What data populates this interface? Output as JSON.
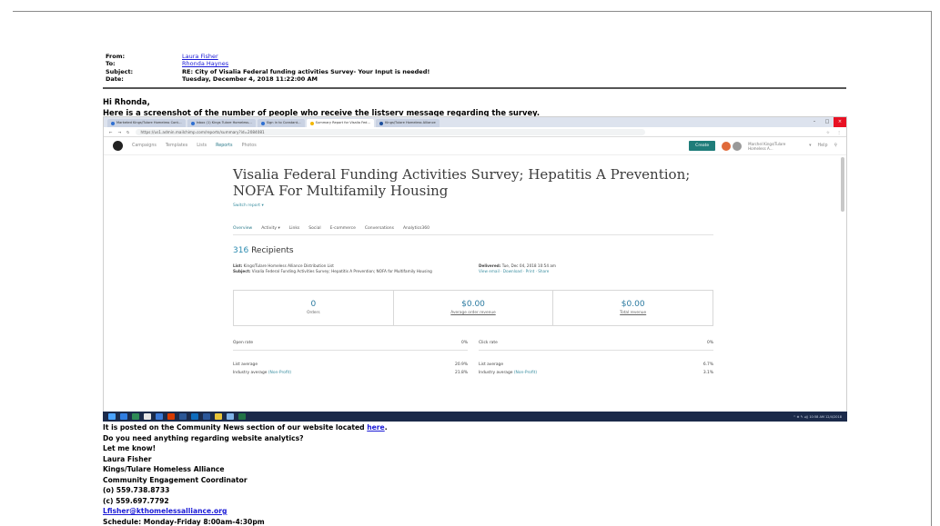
{
  "email": {
    "from_label": "From:",
    "from": "Laura Fisher",
    "to_label": "To:",
    "to": "Rhonda Haynes",
    "subject_label": "Subject:",
    "subject": "RE: City of Visalia Federal funding activities Survey- Your Input is needed!",
    "date_label": "Date:",
    "date": "Tuesday, December 4, 2018 11:22:00 AM",
    "greeting": "Hi Rhonda,",
    "intro": "Here is a screenshot of the number of people who receive the listserv message regarding the survey."
  },
  "browser": {
    "tabs": [
      {
        "label": "Marketed Kings/Tulare Homeless Cont…",
        "color": "#2f6fd1"
      },
      {
        "label": "Inbox (1) Kings Tulare Homeless…",
        "color": "#2f6fd1"
      },
      {
        "label": "Sign in to Constant…",
        "color": "#2f6fd1"
      },
      {
        "label": "Summary Report for Visalia Fed…",
        "color": "#f2b705"
      },
      {
        "label": "Kings/Tulare Homeless Alliance",
        "color": "#1d4f9c"
      }
    ],
    "url": "https://us1.admin.mailchimp.com/reports/summary?id=2084081",
    "win_min": "–",
    "win_max": "□",
    "win_close": "×"
  },
  "mailchimp": {
    "nav": [
      "Campaigns",
      "Templates",
      "Lists",
      "Reports",
      "Photos"
    ],
    "create": "Create",
    "account": "Marchel Kings/Tulare Homeless A…",
    "help": "Help",
    "report_title": "Visalia Federal Funding Activities Survey; Hepatitis A Prevention; NOFA For Multifamily Housing",
    "switch_report": "Switch report ▾",
    "tabs": [
      "Overview",
      "Activity ▾",
      "Links",
      "Social",
      "E-commerce",
      "Conversations",
      "Analytics360"
    ],
    "recipients_count": "316",
    "recipients_label": "Recipients",
    "list_label": "List:",
    "list": "Kings/Tulare Homeless Alliance Distribution List",
    "subject_label": "Subject:",
    "subject": "Visalia Federal Funding Activities Survey; Hepatitis A Prevention; NOFA for Multifamily Housing",
    "delivered_label": "Delivered:",
    "delivered": "Tue, Dec 04, 2018 10:54 am",
    "links": "View email · Download · Print · Share",
    "stats": [
      {
        "value": "0",
        "label": "Orders"
      },
      {
        "value": "$0.00",
        "label": "Average order revenue"
      },
      {
        "value": "$0.00",
        "label": "Total revenue"
      }
    ],
    "open_rate_label": "Open rate",
    "open_rate": "0%",
    "click_rate_label": "Click rate",
    "click_rate": "0%",
    "list_avg_label": "List average",
    "open_list_avg": "20.9%",
    "click_list_avg": "6.7%",
    "industry_label": "Industry average",
    "industry_link": "(Non-Profit)",
    "open_industry": "21.8%",
    "click_industry": "3.1%"
  },
  "taskbar": {
    "tray": "^ ⊕ ✎ ◂)) 10:58 AM 12/4/2018"
  },
  "body": {
    "posted_prefix": "It is posted on the Community News section of our website located ",
    "posted_link": "here",
    "posted_suffix": ".",
    "analytics": "Do you need anything regarding website analytics?",
    "let_me_know": "Let me know!",
    "name": "Laura Fisher",
    "org": "Kings/Tulare Homeless Alliance",
    "title": "Community Engagement Coordinator",
    "office": "(o) 559.738.8733",
    "cell": "(c) 559.697.7792",
    "email": "Lfisher@kthomelessalliance.org",
    "schedule": "Schedule:   Monday-Friday 8:00am-4:30pm"
  }
}
